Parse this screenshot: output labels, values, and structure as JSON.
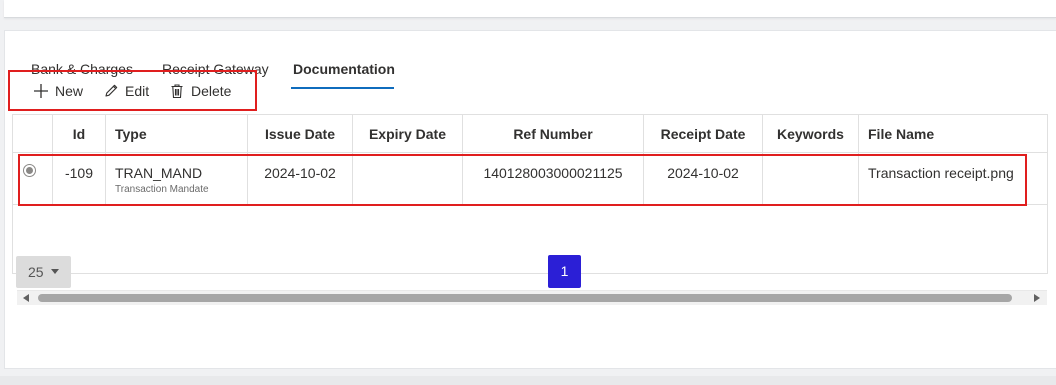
{
  "tabs": [
    {
      "label": "Bank & Charges"
    },
    {
      "label": "Receipt Gateway"
    },
    {
      "label": "Documentation"
    }
  ],
  "toolbar": {
    "new_label": "New",
    "edit_label": "Edit",
    "delete_label": "Delete"
  },
  "grid": {
    "columns": [
      "Id",
      "Type",
      "Issue Date",
      "Expiry Date",
      "Ref Number",
      "Receipt Date",
      "Keywords",
      "File Name"
    ],
    "rows": [
      {
        "selected": true,
        "id": "-109",
        "type": "TRAN_MAND",
        "type_desc": "Transaction Mandate",
        "issue_date": "2024-10-02",
        "expiry_date": "",
        "ref_number": "140128003000021125",
        "receipt_date": "2024-10-02",
        "keywords": "",
        "file_name": "Transaction receipt.png"
      }
    ]
  },
  "pager": {
    "page_size": "25",
    "current_page": "1"
  },
  "colors": {
    "accent": "#0f6cbd",
    "highlight": "#e01e1e",
    "page_button": "#2b1fd6"
  }
}
